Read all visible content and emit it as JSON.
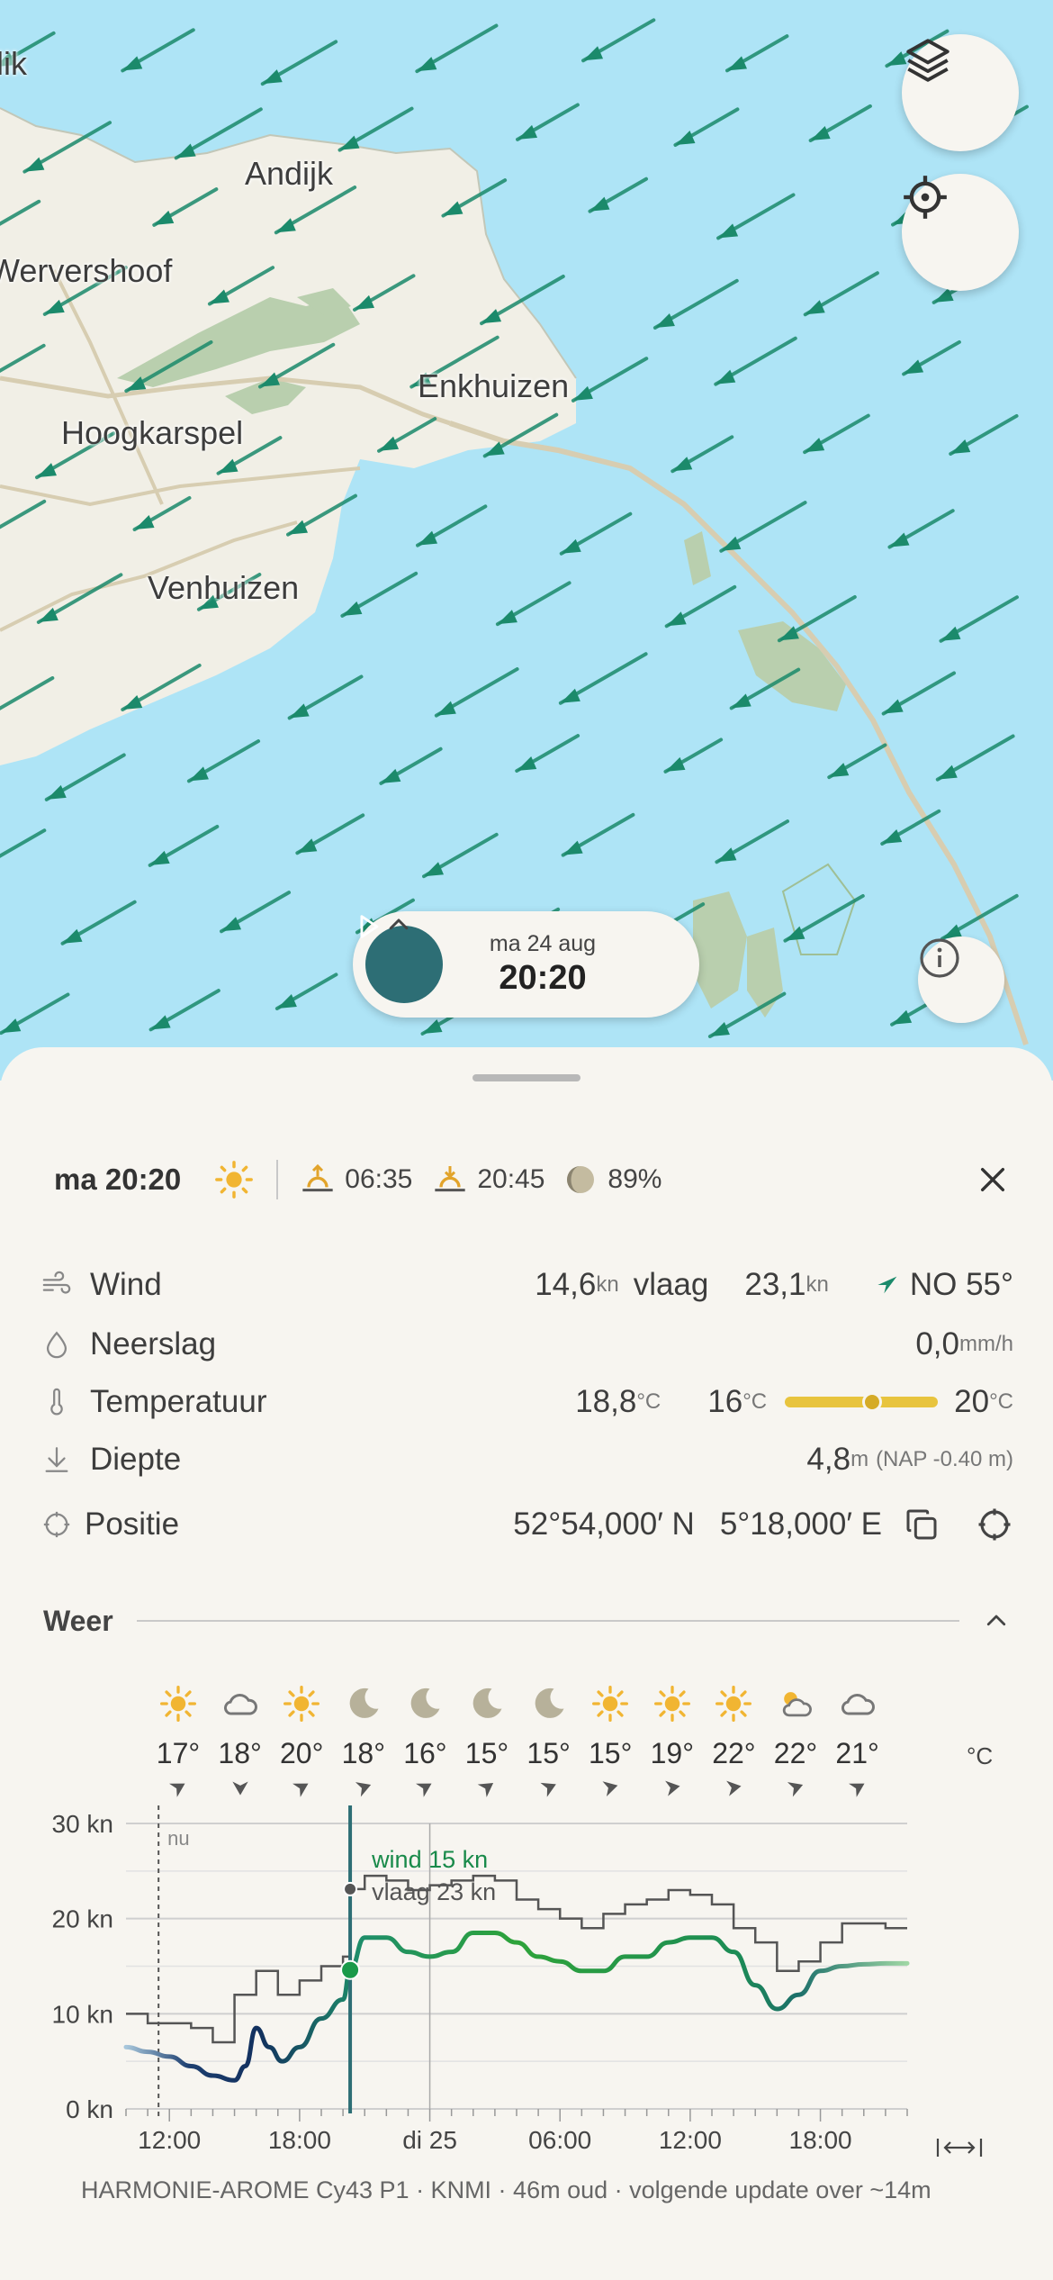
{
  "map": {
    "places": [
      {
        "id": "lik",
        "name": "lik"
      },
      {
        "id": "andijk",
        "name": "Andijk"
      },
      {
        "id": "wervershoof",
        "name": "Wervershoof"
      },
      {
        "id": "enkhuizen",
        "name": "Enkhuizen"
      },
      {
        "id": "hoogkarspel",
        "name": "Hoogkarspel"
      },
      {
        "id": "venhuizen",
        "name": "Venhuizen"
      }
    ],
    "buttons": {
      "layers_icon": "layers-icon",
      "locate_icon": "crosshair-icon",
      "info_icon": "info-icon"
    },
    "water_color": "#aee4f6",
    "land_color": "#f1efe6",
    "arrow_color": "#1b8a6b"
  },
  "time_pill": {
    "date": "ma 24 aug",
    "time": "20:20",
    "play_icon": "play-icon",
    "chevron_icon": "chevron-up-icon"
  },
  "summary": {
    "time": "ma 20:20",
    "weather_icon": "sun-icon",
    "sunrise": "06:35",
    "sunset": "20:45",
    "moon_icon": "moon-phase-icon",
    "moon_pct": "89%",
    "close_icon": "close-icon"
  },
  "details": {
    "wind": {
      "label": "Wind",
      "value": "14,6",
      "unit": "kn",
      "gust_label": "vlaag",
      "gust_value": "23,1",
      "gust_unit": "kn",
      "direction": "NO 55°"
    },
    "precip": {
      "label": "Neerslag",
      "value": "0,0",
      "unit": "mm/h"
    },
    "temp": {
      "label": "Temperatuur",
      "value": "18,8",
      "unit": "°C",
      "min": "16",
      "max": "20",
      "range_unit": "°C",
      "current_position": 0.57
    },
    "depth": {
      "label": "Diepte",
      "value": "4,8",
      "unit": "m",
      "note": "(NAP -0.40 m)"
    },
    "position": {
      "label": "Positie",
      "lat": "52°54,000′ N",
      "lon": "5°18,000′ E"
    }
  },
  "weather_section": {
    "title": "Weer",
    "temp_unit": "°C",
    "forecast": [
      {
        "icon": "sun",
        "temp": "17°",
        "wind_dir": 60
      },
      {
        "icon": "cloud",
        "temp": "18°",
        "wind_dir": 0
      },
      {
        "icon": "sun",
        "temp": "20°",
        "wind_dir": 60
      },
      {
        "icon": "moon",
        "temp": "18°",
        "wind_dir": 70
      },
      {
        "icon": "moon",
        "temp": "16°",
        "wind_dir": 60
      },
      {
        "icon": "moon",
        "temp": "15°",
        "wind_dir": 55
      },
      {
        "icon": "moon",
        "temp": "15°",
        "wind_dir": 65
      },
      {
        "icon": "sun",
        "temp": "15°",
        "wind_dir": 75
      },
      {
        "icon": "sun",
        "temp": "19°",
        "wind_dir": 80
      },
      {
        "icon": "sun",
        "temp": "22°",
        "wind_dir": 80
      },
      {
        "icon": "cloud-sun",
        "temp": "22°",
        "wind_dir": 70
      },
      {
        "icon": "cloud",
        "temp": "21°",
        "wind_dir": 60
      }
    ]
  },
  "chart_data": {
    "type": "line",
    "ylabel": "",
    "y_ticks": [
      "0 kn",
      "10 kn",
      "20 kn",
      "30 kn"
    ],
    "ylim": [
      0,
      30
    ],
    "x_ticks": [
      "12:00",
      "18:00",
      "di 25",
      "06:00",
      "12:00",
      "18:00"
    ],
    "x_range_hours": [
      10,
      46
    ],
    "now_label": "nu",
    "now_hour": 11.5,
    "selected_hour": 20.33,
    "day_boundary_hour": 24,
    "annotation_wind": "wind 15 kn",
    "annotation_gust": "vlaag 23 kn",
    "series": [
      {
        "name": "wind",
        "points": [
          [
            10,
            6.5
          ],
          [
            11,
            6
          ],
          [
            12,
            5.5
          ],
          [
            13,
            4.5
          ],
          [
            14,
            3.5
          ],
          [
            15,
            3
          ],
          [
            15.5,
            4.5
          ],
          [
            16,
            8.5
          ],
          [
            16.6,
            6.5
          ],
          [
            17.2,
            5
          ],
          [
            18,
            6.5
          ],
          [
            19,
            9.5
          ],
          [
            20,
            11.5
          ],
          [
            20.33,
            14.6
          ],
          [
            21,
            18
          ],
          [
            22,
            18
          ],
          [
            23,
            16.5
          ],
          [
            24,
            16
          ],
          [
            25,
            16.5
          ],
          [
            26,
            18.5
          ],
          [
            27,
            18.5
          ],
          [
            28,
            17.5
          ],
          [
            29,
            16
          ],
          [
            30,
            15.5
          ],
          [
            31,
            14.5
          ],
          [
            32,
            14.5
          ],
          [
            33,
            16
          ],
          [
            34,
            16
          ],
          [
            35,
            17.5
          ],
          [
            36,
            18
          ],
          [
            37,
            18
          ],
          [
            38,
            16.5
          ],
          [
            39,
            13
          ],
          [
            40,
            10.5
          ],
          [
            41,
            12
          ],
          [
            42,
            14.5
          ],
          [
            43,
            15
          ],
          [
            44,
            15.2
          ],
          [
            45,
            15.3
          ],
          [
            46,
            15.3
          ]
        ]
      },
      {
        "name": "vlaag",
        "points": [
          [
            10,
            10
          ],
          [
            11,
            9
          ],
          [
            12,
            9
          ],
          [
            13,
            8.5
          ],
          [
            14,
            7
          ],
          [
            15,
            12
          ],
          [
            16,
            14.5
          ],
          [
            17,
            12
          ],
          [
            18,
            13.5
          ],
          [
            19,
            15
          ],
          [
            20,
            16
          ],
          [
            20.33,
            23.1
          ],
          [
            21,
            24.5
          ],
          [
            22,
            24
          ],
          [
            23,
            23
          ],
          [
            24,
            23.5
          ],
          [
            25,
            24
          ],
          [
            26,
            24.5
          ],
          [
            27,
            24
          ],
          [
            28,
            22
          ],
          [
            29,
            21
          ],
          [
            30,
            20
          ],
          [
            31,
            19
          ],
          [
            32,
            20.5
          ],
          [
            33,
            21.5
          ],
          [
            34,
            22
          ],
          [
            35,
            23
          ],
          [
            36,
            22.5
          ],
          [
            37,
            21.5
          ],
          [
            38,
            19
          ],
          [
            39,
            17.5
          ],
          [
            40,
            14.5
          ],
          [
            41,
            15.5
          ],
          [
            42,
            17.5
          ],
          [
            43,
            19.5
          ],
          [
            44,
            19.5
          ],
          [
            45,
            19
          ],
          [
            46,
            19
          ]
        ]
      }
    ]
  },
  "footer": {
    "source": "HARMONIE-AROME Cy43 P1 · KNMI · 46m oud · volgende update over ~14m"
  }
}
